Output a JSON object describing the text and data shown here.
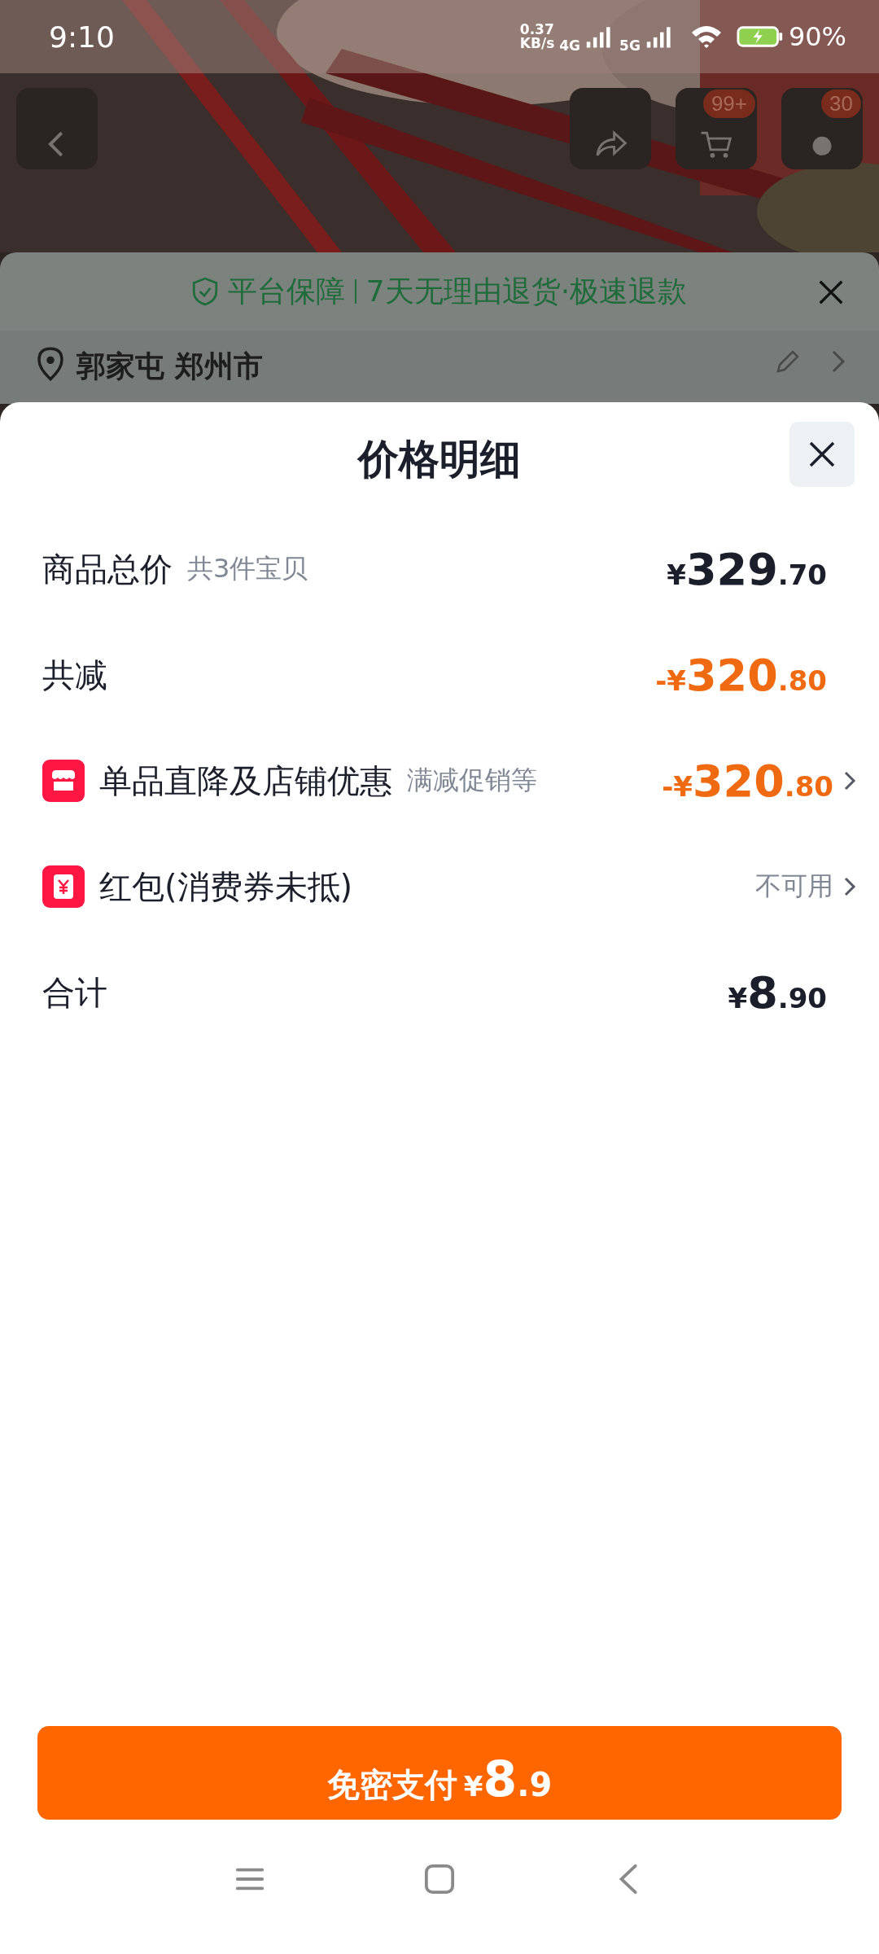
{
  "status_bar": {
    "time": "9:10",
    "speed_value": "0.37",
    "speed_unit": "KB/s",
    "network_1": "4G",
    "network_2": "5G",
    "battery": "90%"
  },
  "top_bar": {
    "kind": "picture",
    "cart_badge": "99+",
    "message_badge": "30"
  },
  "guarantee": {
    "title": "平台保障",
    "text": "7天无理由退货·极速退款"
  },
  "address": {
    "text": "郭家屯 郑州市"
  },
  "sheet": {
    "title": "价格明细",
    "rows": [
      {
        "kind": "amount",
        "label": "商品总价",
        "note": "共3件宝贝",
        "discount": false,
        "arrow": false,
        "sign": "",
        "currency": "¥",
        "integer": "329",
        "decimal": ".70"
      },
      {
        "kind": "amount",
        "label": "共减",
        "discount": true,
        "arrow": false,
        "sign": "-",
        "currency": "¥",
        "integer": "320",
        "decimal": ".80"
      },
      {
        "kind": "store",
        "label": "单品直降及店铺优惠",
        "note": "满减促销等",
        "discount": true,
        "arrow": true,
        "sign": "-",
        "currency": "¥",
        "integer": "320",
        "decimal": ".80"
      },
      {
        "kind": "coupon",
        "label": "红包(消费券未抵)",
        "value": "不可用",
        "arrow": true
      },
      {
        "kind": "amount",
        "label": "合计",
        "discount": false,
        "arrow": false,
        "sign": "",
        "currency": "¥",
        "integer": "8",
        "decimal": ".90"
      }
    ]
  },
  "pay_button": {
    "label": "免密支付",
    "currency": "¥",
    "integer": "8",
    "decimal": ".9"
  }
}
